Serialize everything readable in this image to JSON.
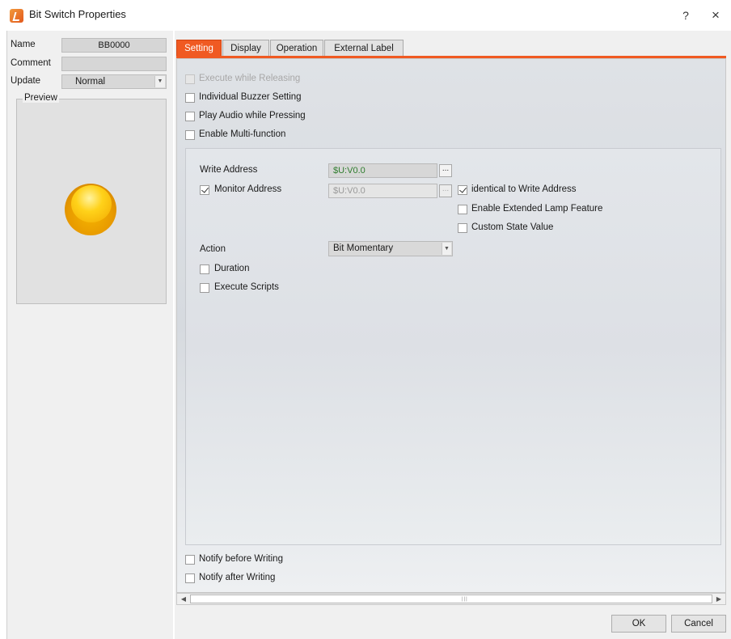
{
  "window": {
    "title": "Bit Switch Properties",
    "help_label": "?",
    "close_label": "×"
  },
  "left": {
    "name_label": "Name",
    "name_value": "BB0000",
    "comment_label": "Comment",
    "comment_value": "",
    "update_label": "Update",
    "update_value": "Normal",
    "preview_label": "Preview"
  },
  "tabs": [
    {
      "label": "Setting",
      "active": true
    },
    {
      "label": "Display",
      "active": false
    },
    {
      "label": "Operation",
      "active": false
    },
    {
      "label": "External Label",
      "active": false
    }
  ],
  "setting": {
    "execute_while_releasing": {
      "label": "Execute while Releasing",
      "checked": false,
      "enabled": false
    },
    "individual_buzzer": {
      "label": "Individual Buzzer Setting",
      "checked": false
    },
    "play_audio": {
      "label": "Play Audio while Pressing",
      "checked": false
    },
    "enable_multi": {
      "label": "Enable Multi-function",
      "checked": false
    },
    "write_address_label": "Write Address",
    "write_address_value": "$U:V0.0",
    "monitor_address": {
      "label": "Monitor Address",
      "checked": true
    },
    "monitor_address_value": "$U:V0.0",
    "identical_to_write": {
      "label": "identical to Write Address",
      "checked": true
    },
    "enable_extended_lamp": {
      "label": "Enable Extended Lamp Feature",
      "checked": false
    },
    "custom_state_value": {
      "label": "Custom State Value",
      "checked": false
    },
    "action_label": "Action",
    "action_value": "Bit Momentary",
    "duration": {
      "label": "Duration",
      "checked": false
    },
    "execute_scripts": {
      "label": "Execute Scripts",
      "checked": false
    },
    "notify_before": {
      "label": "Notify before Writing",
      "checked": false
    },
    "notify_after": {
      "label": "Notify after Writing",
      "checked": false
    },
    "browse_label": "..."
  },
  "scrollbar": {
    "left_arrow": "◀",
    "right_arrow": "▶",
    "grip": "|||"
  },
  "buttons": {
    "ok": "OK",
    "cancel": "Cancel"
  },
  "colors": {
    "accent": "#f05a22",
    "address_text": "#2e7d2e"
  }
}
